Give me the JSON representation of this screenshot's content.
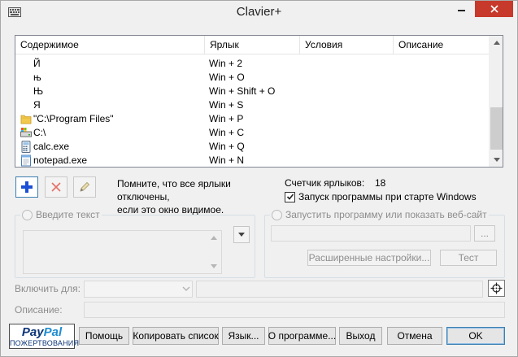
{
  "window": {
    "title": "Clavier+"
  },
  "list": {
    "columns": [
      "Содержимое",
      "Ярлык",
      "Условия",
      "Описание"
    ],
    "rows": [
      {
        "content": "Й",
        "shortcut": "Win + 2",
        "icon": "none"
      },
      {
        "content": "њ",
        "shortcut": "Win + O",
        "icon": "none"
      },
      {
        "content": "Њ",
        "shortcut": "Win + Shift + O",
        "icon": "none"
      },
      {
        "content": "Я",
        "shortcut": "Win + S",
        "icon": "none"
      },
      {
        "content": "\"C:\\Program Files\"",
        "shortcut": "Win + P",
        "icon": "folder-icon"
      },
      {
        "content": "C:\\",
        "shortcut": "Win + C",
        "icon": "drive-icon"
      },
      {
        "content": "calc.exe",
        "shortcut": "Win + Q",
        "icon": "calculator-icon"
      },
      {
        "content": "notepad.exe",
        "shortcut": "Win + N",
        "icon": "notepad-icon"
      }
    ]
  },
  "info": {
    "line1": "Помните, что все ярлыки отключены,",
    "line2": "если это окно видимое.",
    "counter_label": "Счетчик ярлыков:",
    "counter_value": "18",
    "launch_at_startup_label": "Запуск программы при старте Windows",
    "launch_at_startup_checked": true
  },
  "text_group": {
    "label": "Введите текст"
  },
  "launch_group": {
    "label": "Запустить программу или показать веб-сайт",
    "browse_label": "...",
    "advanced_label": "Расширенные настройки...",
    "test_label": "Тест"
  },
  "form": {
    "enable_for_label": "Включить для:",
    "description_label": "Описание:"
  },
  "paypal": {
    "brand_dark": "Pay",
    "brand_light": "Pal",
    "donate": "ПОЖЕРТВОВАНИЯ"
  },
  "buttons": {
    "help": "Помощь",
    "copy_list": "Копировать список",
    "language": "Язык...",
    "about": "О программе...",
    "exit": "Выход",
    "cancel": "Отмена",
    "ok": "OK"
  },
  "colors": {
    "close": "#c7392b",
    "accent": "#3c7fb1",
    "add": "#1a4fd6",
    "delete": "#e0443a"
  }
}
